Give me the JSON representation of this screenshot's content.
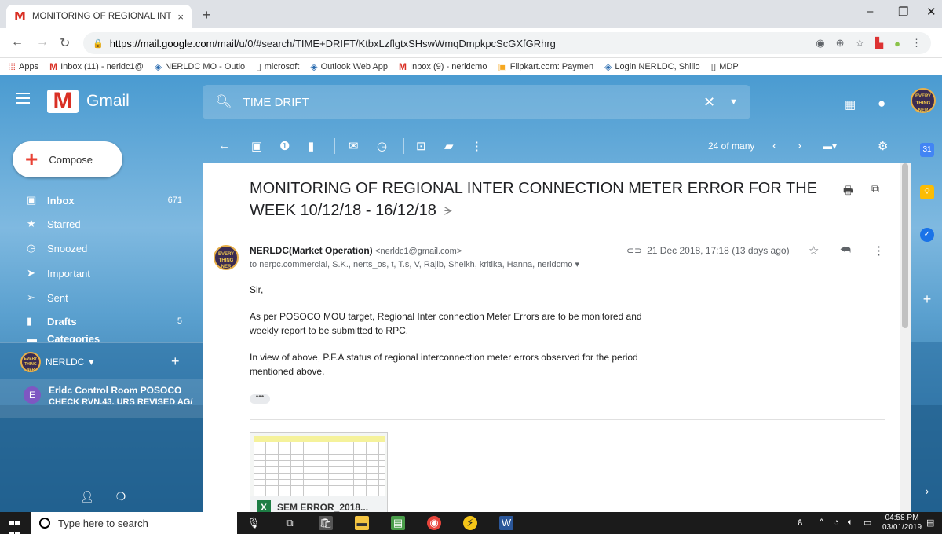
{
  "browser": {
    "tab_title": "MONITORING OF REGIONAL INT",
    "tab_close": "×",
    "new_tab": "+",
    "url_host": "https://mail.google.com",
    "url_path": "/mail/u/0/#search/TIME+DRIFT/KtbxLzflgtxSHswWmqDmpkpcScGXfGRhrg"
  },
  "bookmarks": [
    {
      "label": "Apps"
    },
    {
      "label": "Inbox (11) - nerldc1@"
    },
    {
      "label": "NERLDC MO - Outlo"
    },
    {
      "label": "microsoft"
    },
    {
      "label": "Outlook Web App"
    },
    {
      "label": "Inbox (9) - nerldcmo"
    },
    {
      "label": "Flipkart.com: Paymen"
    },
    {
      "label": "Login NERLDC, Shillo"
    },
    {
      "label": "MDP"
    }
  ],
  "gmail": {
    "logo_text": "Gmail",
    "search_value": "TIME DRIFT",
    "compose_label": "Compose",
    "nav": [
      {
        "label": "Inbox",
        "count": "671"
      },
      {
        "label": "Starred",
        "count": ""
      },
      {
        "label": "Snoozed",
        "count": ""
      },
      {
        "label": "Important",
        "count": ""
      },
      {
        "label": "Sent",
        "count": ""
      },
      {
        "label": "Drafts",
        "count": "5"
      },
      {
        "label": "Categories",
        "count": ""
      }
    ],
    "account_label": "NERLDC",
    "chat": {
      "initial": "E",
      "name": "Erldc Control Room POSOCO",
      "preview": "CHECK RVN.43. URS REVISED AG/"
    },
    "pager": "24 of many"
  },
  "message": {
    "subject": "MONITORING OF REGIONAL INTER CONNECTION METER ERROR FOR THE WEEK 10/12/18 - 16/12/18",
    "sender_name": "NERLDC(Market Operation)",
    "sender_email": "<nerldc1@gmail.com>",
    "to_line": "to nerpc.commercial, S.K., nerts_os, t, T.s, V, Rajib, Sheikh, kritika, Hanna, nerldcmo",
    "date": "21 Dec 2018, 17:18 (13 days ago)",
    "greeting": "Sir,",
    "para1": "As per POSOCO MOU target, Regional Inter connection Meter Errors are to be monitored and weekly report to be submitted to RPC.",
    "para2": "In view of above, P.F.A status of regional interconnection meter errors observed for the period mentioned above.",
    "ellipsis": "•••",
    "attachment_name": "SEM ERROR_2018..."
  },
  "taskbar": {
    "search_placeholder": "Type here to search",
    "time": "04:58 PM",
    "date": "03/01/2019"
  },
  "colors": {
    "gmail_red": "#d93025",
    "sea_blue": "#2c7fb8",
    "excel_green": "#1e7e45"
  }
}
